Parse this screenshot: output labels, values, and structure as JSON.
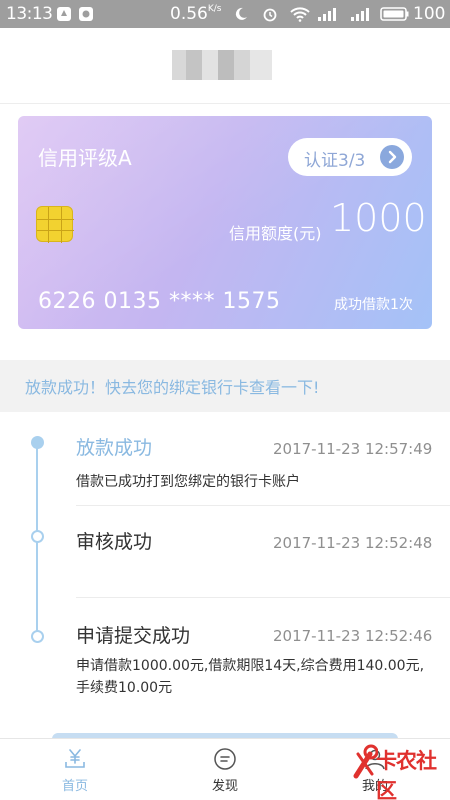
{
  "status_bar": {
    "time": "13:13",
    "speed": "0.56",
    "speed_unit": "K/s",
    "battery": "100"
  },
  "card": {
    "rating": "信用评级A",
    "verify_label": "认证3/3",
    "limit_label": "信用额度(元)",
    "limit_value": "1000",
    "card_number": "6226  0135  ****  1575",
    "loan_count": "成功借款1次",
    "colors": {
      "gradient_start": "#dac0f2",
      "gradient_end": "#a4c2f7"
    }
  },
  "notice": {
    "text": "放款成功！快去您的绑定银行卡查看一下!"
  },
  "timeline": [
    {
      "title": "放款成功",
      "time": "2017-11-23  12:57:49",
      "desc": "借款已成功打到您绑定的银行卡账户",
      "active": true
    },
    {
      "title": "审核成功",
      "time": "2017-11-23  12:52:48",
      "desc": "",
      "active": false
    },
    {
      "title": "申请提交成功",
      "time": "2017-11-23  12:52:46",
      "desc": "申请借款1000.00元,借款期限14天,综合费用140.00元,手续费10.00元",
      "active": false
    }
  ],
  "tabs": [
    {
      "label": "首页",
      "icon": "home-yen-icon",
      "active": true
    },
    {
      "label": "发现",
      "icon": "discover-icon",
      "active": false
    },
    {
      "label": "我的",
      "icon": "profile-icon",
      "active": false
    }
  ],
  "watermark": {
    "text": "卡农社区",
    "icon": "wrench-icon"
  },
  "theme": {
    "accent": "#8ab9e1",
    "timeline_color": "#a9d0ee"
  }
}
